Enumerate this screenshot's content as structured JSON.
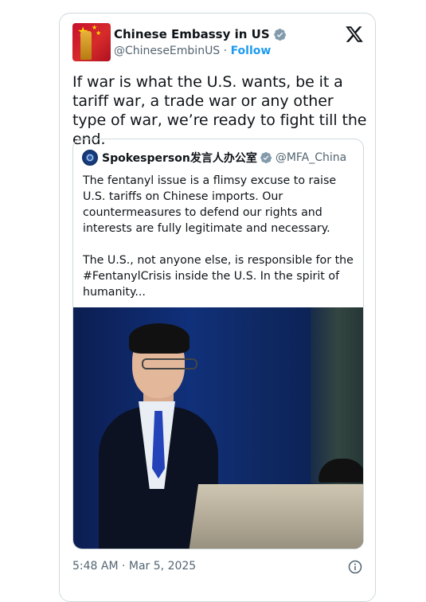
{
  "tweet": {
    "author": {
      "display_name": "Chinese Embassy in US",
      "handle": "@ChineseEmbinUS",
      "separator": " · ",
      "follow_label": "Follow",
      "verified_color": "#829aab"
    },
    "text": "If war is what the U.S. wants, be it a tariff war, a trade war or any other type of war, we’re ready to fight till the end.",
    "timestamp": "5:48 AM · Mar 5, 2025"
  },
  "quoted_tweet": {
    "display_name": "Spokesperson发言人办公室",
    "handle": "@MFA_China",
    "paragraphs": [
      "The fentanyl issue is a flimsy excuse to raise U.S. tariffs on Chinese imports. Our countermeasures to defend our rights and interests are fully legitimate and necessary.",
      "The U.S., not anyone else, is responsible for the #FentanylCrisis inside the U.S. In the spirit of humanity..."
    ],
    "media": "photo"
  },
  "icons": {
    "platform_logo": "x-logo-icon",
    "verified": "verified-badge-icon",
    "info": "info-icon"
  },
  "colors": {
    "link": "#1d9bf0",
    "secondary_text": "#536471",
    "border": "#cfd9de"
  }
}
